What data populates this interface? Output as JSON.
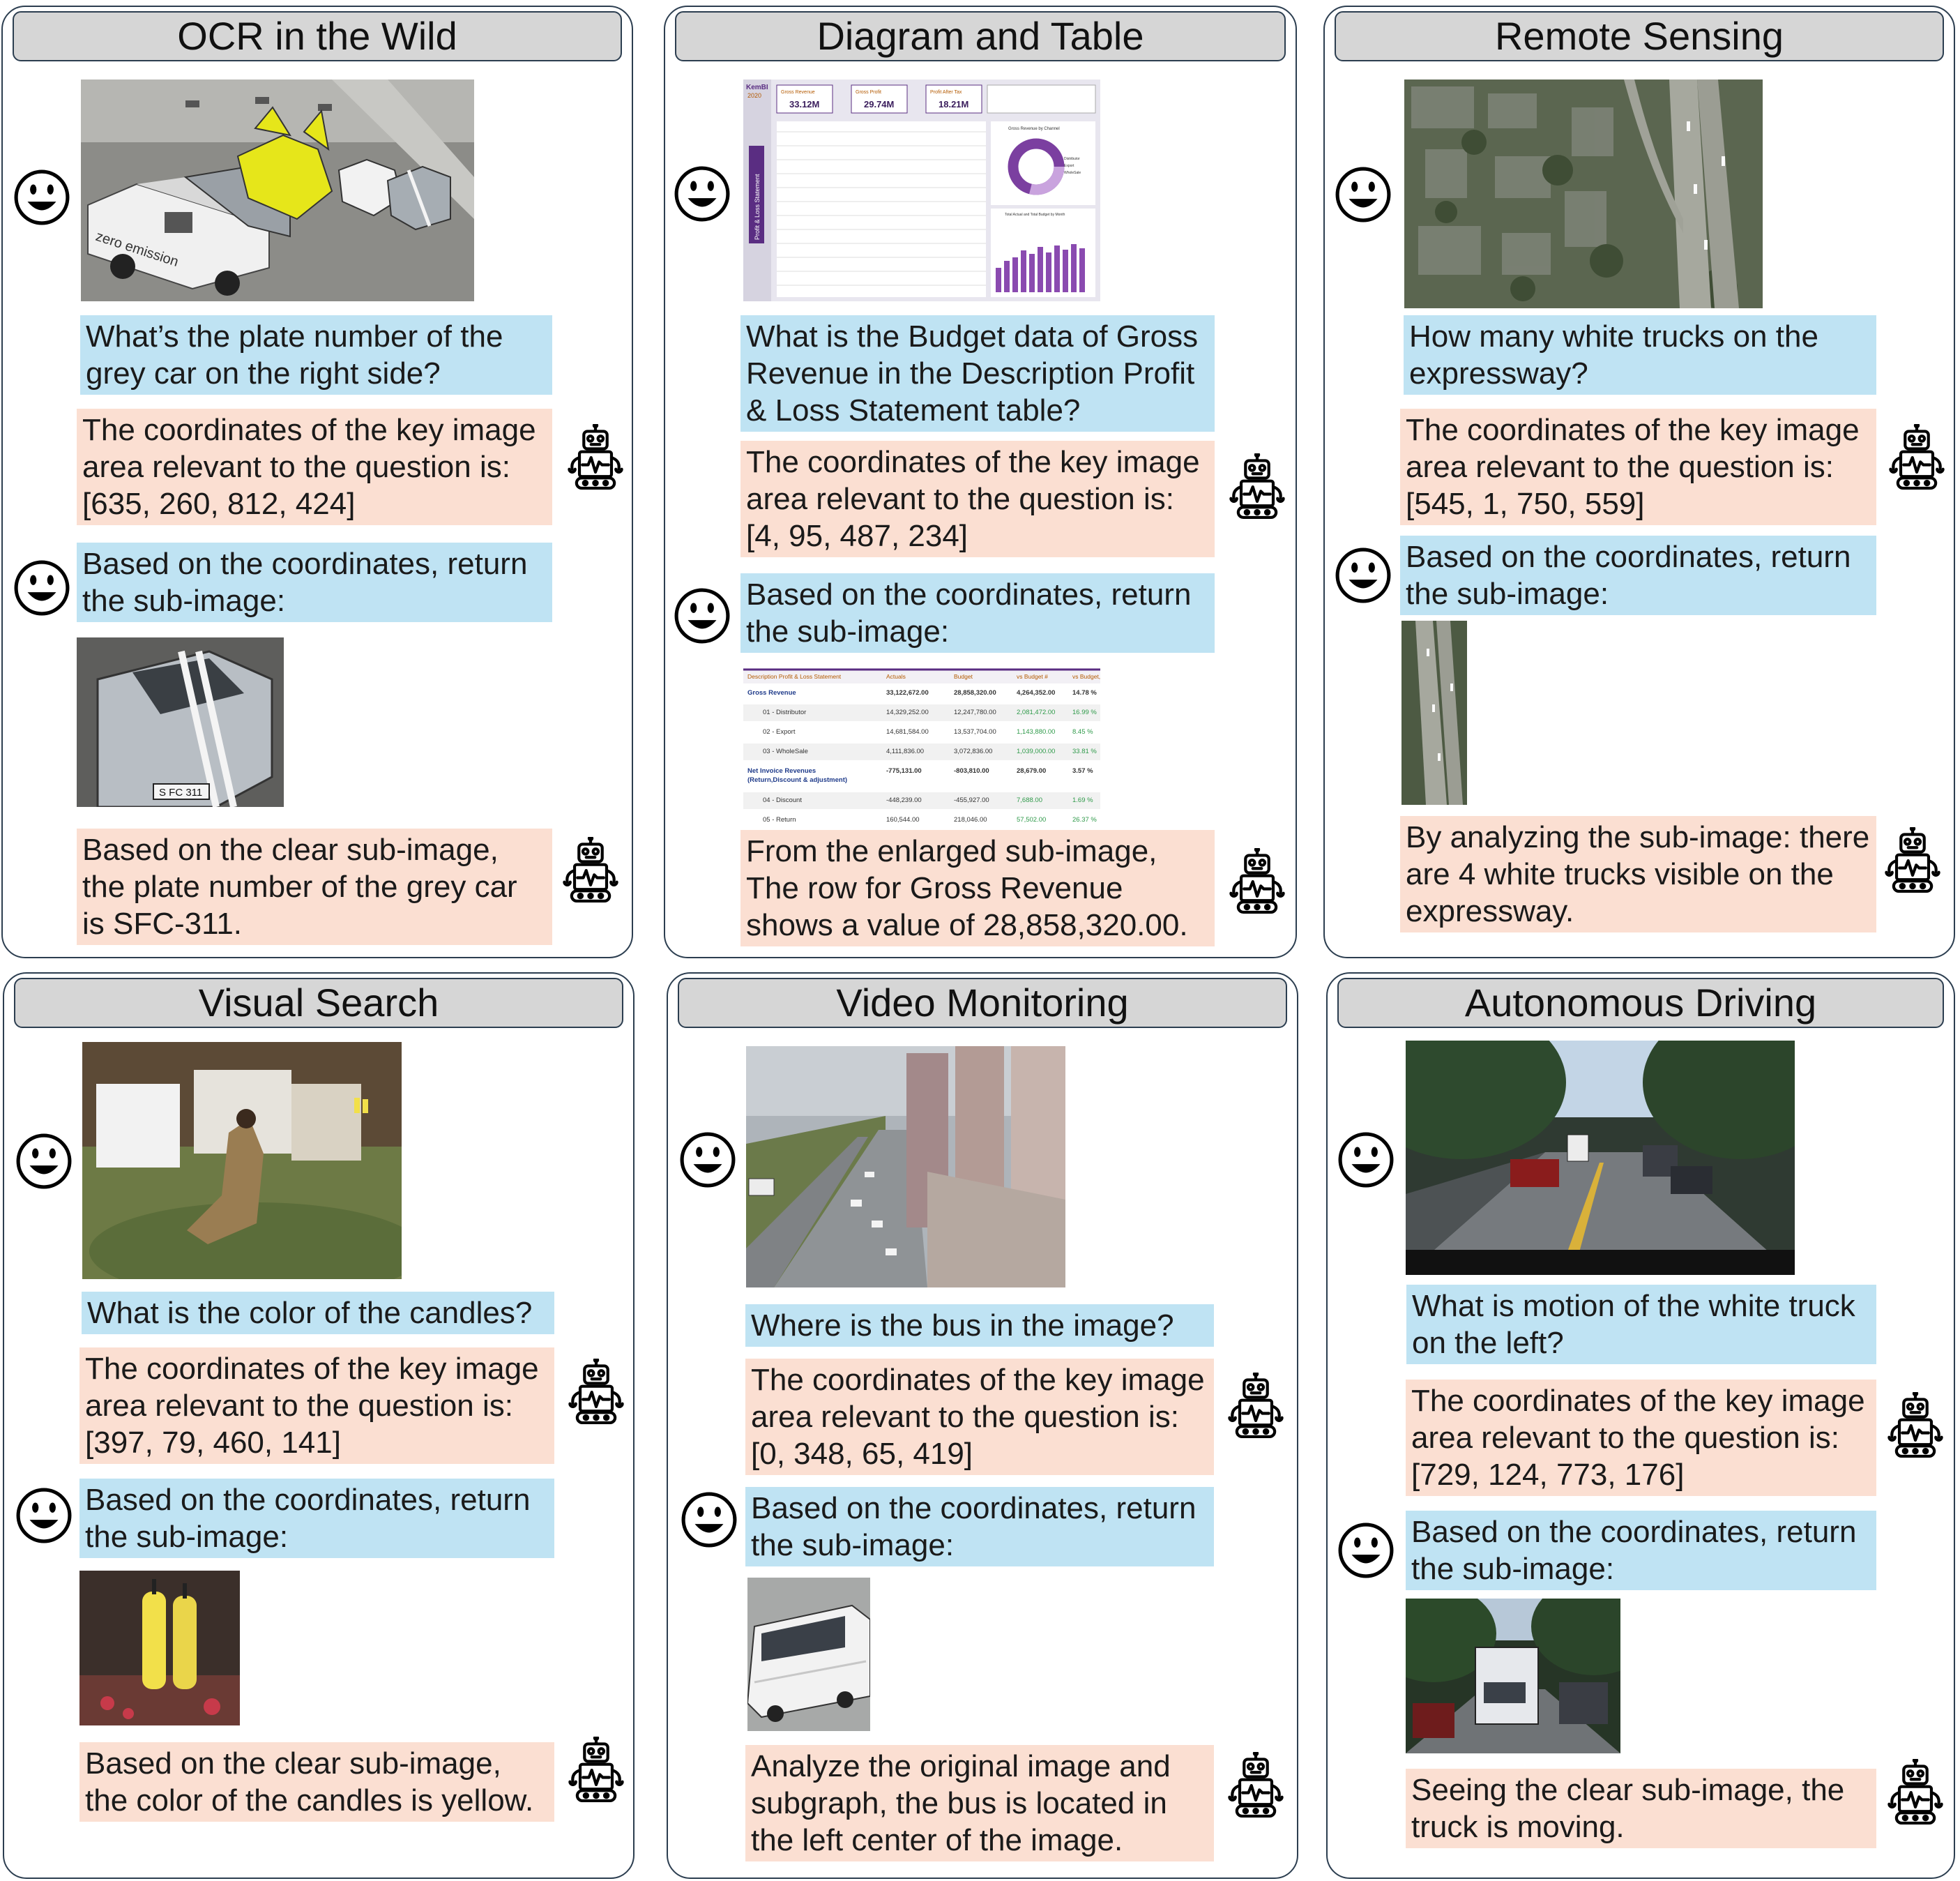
{
  "panels": [
    {
      "title": "OCR in the Wild",
      "question": "What’s the plate number of the grey car on the right side?",
      "coords_text": "The coordinates of the key image area relevant to the question is: [635, 260, 812, 424]",
      "return_text": "Based on the coordinates, return the sub-image:",
      "answer": "Based on the clear sub-image, the plate number of the grey car is SFC-311."
    },
    {
      "title": "Diagram and Table",
      "question": "What is the Budget data of Gross Revenue in the Description Profit & Loss Statement table?",
      "coords_text": "The coordinates of the key image area relevant to the question is: [4, 95, 487, 234]",
      "return_text": "Based on the coordinates, return the sub-image:",
      "answer": "From the enlarged sub-image, The row for Gross Revenue shows a value of 28,858,320.00."
    },
    {
      "title": "Remote Sensing",
      "question": "How many white trucks on the expressway?",
      "coords_text": "The coordinates of the key image area relevant to the question is: [545, 1, 750, 559]",
      "return_text": "Based on the coordinates, return the sub-image:",
      "answer": "By analyzing the sub-image: there are 4 white trucks visible on the expressway."
    },
    {
      "title": "Visual Search",
      "question": "What is the color of the candles?",
      "coords_text": "The coordinates of the key image area relevant to the question is: [397, 79, 460, 141]",
      "return_text": "Based on the coordinates, return the sub-image:",
      "answer": "Based on the clear sub-image, the color of the candles is yellow."
    },
    {
      "title": "Video Monitoring",
      "question": "Where is the bus in the image?",
      "coords_text": "The coordinates of the key image area relevant to the question is: [0, 348, 65, 419]",
      "return_text": "Based on the coordinates, return the sub-image:",
      "answer": "Analyze the original image and subgraph, the bus is located in the left center of the image."
    },
    {
      "title": "Autonomous Driving",
      "question": "What is motion of the white truck on the left?",
      "coords_text": "The coordinates of the key image area relevant to the question is: [729, 124, 773, 176]",
      "return_text": "Based on the coordinates, return the sub-image:",
      "answer": "Seeing the clear sub-image, the truck is moving."
    }
  ],
  "image_text": {
    "van_lettering": "zero emission",
    "plate": "S FC 311",
    "dashboard_brand": "KemBI",
    "dashboard_year": "2020",
    "kpi_labels": [
      "Gross Revenue",
      "Gross Profit",
      "Profit After Tax"
    ],
    "kpi_values": [
      "33.12M",
      "29.74M",
      "18.21M"
    ],
    "dashboard_sidebar": "Profit & Loss Statement",
    "donut_title": "Gross Revenue by Channel",
    "donut_legend": [
      "Distributor",
      "Export",
      "WholeSale"
    ],
    "bars_title": "Total Actual and Total Budget by Month",
    "table_headers": [
      "Description Profit & Loss Statement",
      "Actuals",
      "Budget",
      "vs Budget #",
      "vs Budget, %"
    ],
    "table_rows": [
      [
        "Gross Revenue",
        "33,122,672.00",
        "28,858,320.00",
        "4,264,352.00",
        "14.78 %"
      ],
      [
        "01 - Distributor",
        "14,329,252.00",
        "12,247,780.00",
        "2,081,472.00",
        "16.99 %"
      ],
      [
        "02 - Export",
        "14,681,584.00",
        "13,537,704.00",
        "1,143,880.00",
        "8.45 %"
      ],
      [
        "03 - WholeSale",
        "4,111,836.00",
        "3,072,836.00",
        "1,039,000.00",
        "33.81 %"
      ],
      [
        "Net Invoice Revenues (Return,Discount & adjustment)",
        "-775,131.00",
        "-803,810.00",
        "28,679.00",
        "3.57 %"
      ],
      [
        "04 - Discount",
        "-448,239.00",
        "-455,927.00",
        "7,688.00",
        "1.69 %"
      ],
      [
        "05 - Return",
        "160,544.00",
        "218,046.00",
        "57,502.00",
        "26.37 %"
      ]
    ]
  },
  "colors": {
    "question_bg": "#bfe3f3",
    "answer_bg": "#fbdfd2",
    "title_bg": "#d6d6d6",
    "border": "#2c3e50"
  }
}
